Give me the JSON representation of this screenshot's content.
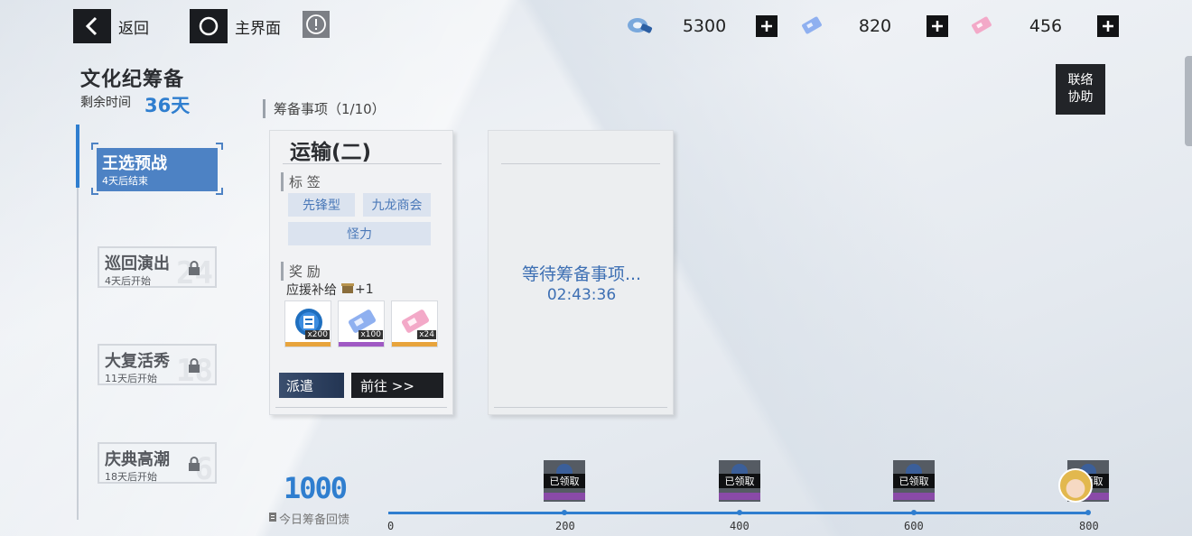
{
  "topbar": {
    "back_label": "返回",
    "home_label": "主界面",
    "alert_icon": "exclamation-circle-icon"
  },
  "resources": [
    {
      "icon": "blue-gear-token-icon",
      "value": "5300"
    },
    {
      "icon": "blue-supply-ticket-icon",
      "value": "820"
    },
    {
      "icon": "pink-supply-ticket-icon",
      "value": "456"
    }
  ],
  "event": {
    "title": "文化纪筹备",
    "remaining_label": "剩余时间",
    "remaining_value": "36天"
  },
  "stages": [
    {
      "name": "王选预战",
      "sub": "4天后结束",
      "num": "",
      "locked": false,
      "active": true
    },
    {
      "name": "巡回演出",
      "sub": "4天后开始",
      "num": "24",
      "locked": true,
      "active": false
    },
    {
      "name": "大复活秀",
      "sub": "11天后开始",
      "num": "18",
      "locked": true,
      "active": false
    },
    {
      "name": "庆典高潮",
      "sub": "18天后开始",
      "num": "6",
      "locked": true,
      "active": false
    }
  ],
  "tasks": {
    "header": "筹备事项（1/10）",
    "card": {
      "title": "运输(二)",
      "tags_header": "标 签",
      "tags": [
        "先锋型",
        "九龙商会",
        "怪力"
      ],
      "rewards_header": "奖 励",
      "supply_label": "应援补给",
      "supply_count": "+1",
      "reward_items": [
        {
          "icon": "blue-coin-token-icon",
          "count": "x200"
        },
        {
          "icon": "blue-supply-ticket-icon",
          "count": "x100"
        },
        {
          "icon": "pink-supply-ticket-icon",
          "count": "x24"
        }
      ],
      "dispatch_label": "派遣",
      "goto_label": "前往 >>"
    },
    "waiting": {
      "text": "等待筹备事项...",
      "timer": "02:43:36"
    }
  },
  "assist_button": {
    "line1": "联络",
    "line2": "协助"
  },
  "daily_progress": {
    "value": "1000",
    "label": "今日筹备回馈",
    "ticks": [
      "0",
      "200",
      "400",
      "600",
      "800"
    ],
    "progress_fraction": 1.0,
    "milestones": [
      {
        "at": 200,
        "status": "已领取"
      },
      {
        "at": 400,
        "status": "已领取"
      },
      {
        "at": 600,
        "status": "已领取"
      },
      {
        "at": 800,
        "status": "已领取"
      }
    ]
  },
  "colors": {
    "accent": "#2f7ecf",
    "active_stage": "#4d82c4",
    "tag_text": "#4a78b8"
  }
}
